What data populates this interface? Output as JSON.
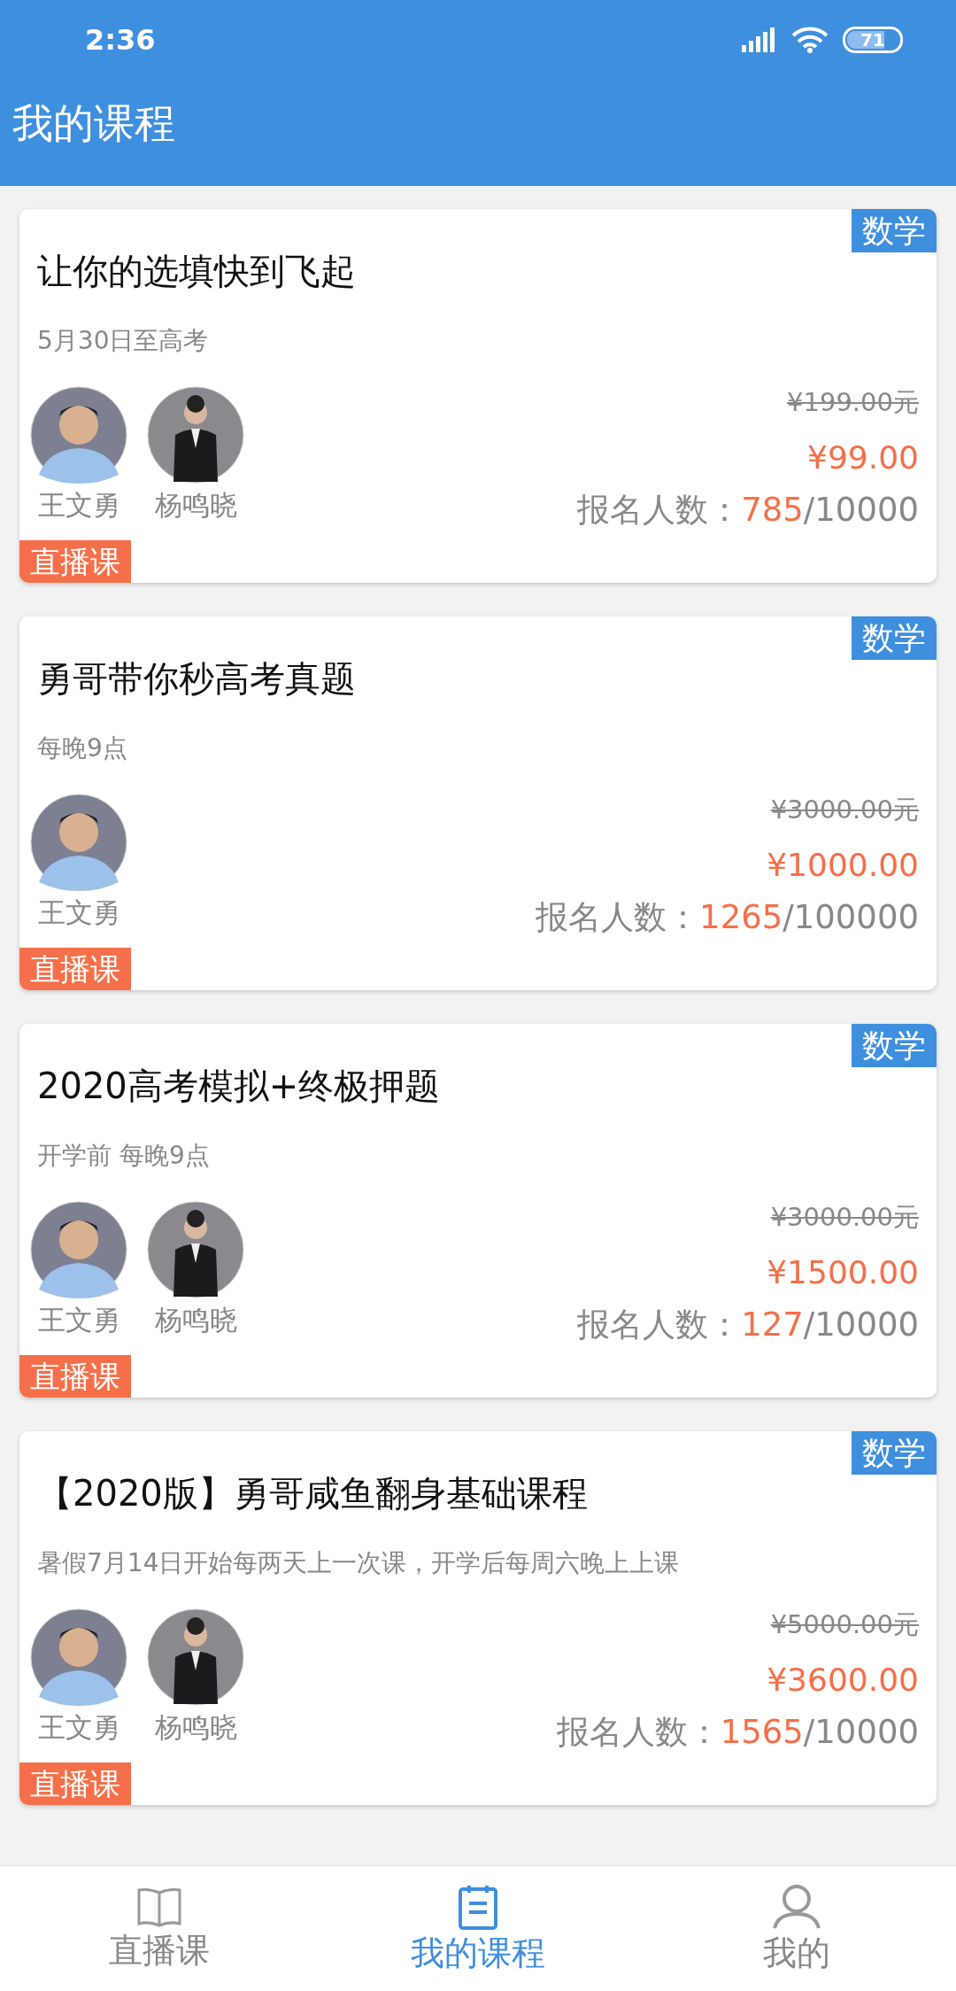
{
  "status_bar": {
    "time": "2:36",
    "battery": "71"
  },
  "app_bar": {
    "title": "我的课程"
  },
  "courses": [
    {
      "subject": "数学",
      "title": "让你的选填快到飞起",
      "schedule": "5月30日至高考",
      "teachers": [
        {
          "name": "王文勇"
        },
        {
          "name": "杨鸣晓"
        }
      ],
      "tag": "直播课",
      "old_price": "¥199.00元",
      "price": "¥99.00",
      "enroll_label": "报名人数：",
      "enrolled": "785",
      "capacity": "/10000"
    },
    {
      "subject": "数学",
      "title": "勇哥带你秒高考真题",
      "schedule": "每晚9点",
      "teachers": [
        {
          "name": "王文勇"
        }
      ],
      "tag": "直播课",
      "old_price": "¥3000.00元",
      "price": "¥1000.00",
      "enroll_label": "报名人数：",
      "enrolled": "1265",
      "capacity": "/100000"
    },
    {
      "subject": "数学",
      "title": "2020高考模拟+终极押题",
      "schedule": "开学前 每晚9点",
      "teachers": [
        {
          "name": "王文勇"
        },
        {
          "name": "杨鸣晓"
        }
      ],
      "tag": "直播课",
      "old_price": "¥3000.00元",
      "price": "¥1500.00",
      "enroll_label": "报名人数：",
      "enrolled": "127",
      "capacity": "/10000"
    },
    {
      "subject": "数学",
      "title": "【2020版】勇哥咸鱼翻身基础课程",
      "schedule": "暑假7月14日开始每两天上一次课，开学后每周六晚上上课",
      "teachers": [
        {
          "name": "王文勇"
        },
        {
          "name": "杨鸣晓"
        }
      ],
      "tag": "直播课",
      "old_price": "¥5000.00元",
      "price": "¥3600.00",
      "enroll_label": "报名人数：",
      "enrolled": "1565",
      "capacity": "/10000"
    }
  ],
  "bottom_nav": [
    {
      "label": "直播课",
      "kind": "book",
      "selected": false
    },
    {
      "label": "我的课程",
      "kind": "notepad",
      "selected": true
    },
    {
      "label": "我的",
      "kind": "person",
      "selected": false
    }
  ]
}
